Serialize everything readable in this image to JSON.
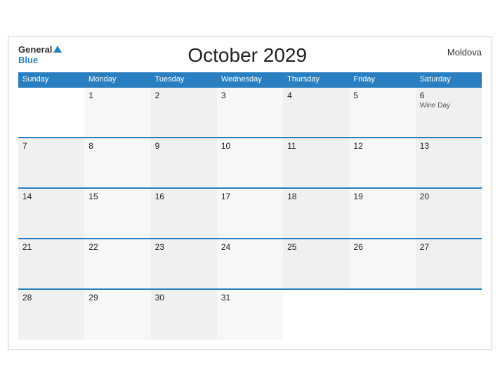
{
  "header": {
    "logo_general": "General",
    "logo_blue": "Blue",
    "title": "October 2029",
    "country": "Moldova"
  },
  "weekdays": [
    "Sunday",
    "Monday",
    "Tuesday",
    "Wednesday",
    "Thursday",
    "Friday",
    "Saturday"
  ],
  "weeks": [
    [
      {
        "day": "",
        "empty": true
      },
      {
        "day": "1"
      },
      {
        "day": "2"
      },
      {
        "day": "3"
      },
      {
        "day": "4"
      },
      {
        "day": "5"
      },
      {
        "day": "6",
        "holiday": "Wine Day"
      }
    ],
    [
      {
        "day": "7"
      },
      {
        "day": "8"
      },
      {
        "day": "9"
      },
      {
        "day": "10"
      },
      {
        "day": "11"
      },
      {
        "day": "12"
      },
      {
        "day": "13"
      }
    ],
    [
      {
        "day": "14"
      },
      {
        "day": "15"
      },
      {
        "day": "16"
      },
      {
        "day": "17"
      },
      {
        "day": "18"
      },
      {
        "day": "19"
      },
      {
        "day": "20"
      }
    ],
    [
      {
        "day": "21"
      },
      {
        "day": "22"
      },
      {
        "day": "23"
      },
      {
        "day": "24"
      },
      {
        "day": "25"
      },
      {
        "day": "26"
      },
      {
        "day": "27"
      }
    ],
    [
      {
        "day": "28"
      },
      {
        "day": "29"
      },
      {
        "day": "30"
      },
      {
        "day": "31"
      },
      {
        "day": "",
        "empty": true
      },
      {
        "day": "",
        "empty": true
      },
      {
        "day": "",
        "empty": true
      }
    ]
  ]
}
